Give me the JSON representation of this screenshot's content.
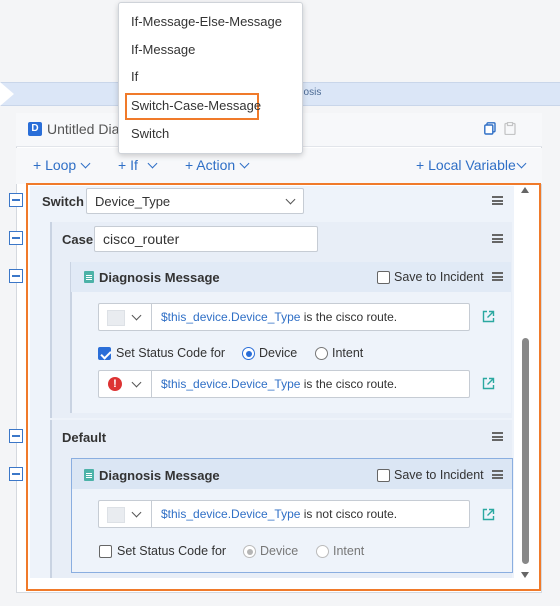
{
  "ribbon": {
    "text": "nosis"
  },
  "editor": {
    "title": "Untitled Dia",
    "badge": "D"
  },
  "toolbar": {
    "loop": "+ Loop",
    "if": "+ If",
    "action": "+ Action",
    "local_variable": "+ Local Variable"
  },
  "menu": {
    "items": [
      {
        "label": "If-Message-Else-Message"
      },
      {
        "label": "If-Message"
      },
      {
        "label": "If"
      },
      {
        "label": "Switch-Case-Message"
      },
      {
        "label": "Switch"
      }
    ]
  },
  "switch_block": {
    "label": "Switch",
    "value": "Device_Type"
  },
  "case_block": {
    "label": "Case",
    "value": "cisco_router"
  },
  "diag1": {
    "title": "Diagnosis Message",
    "save_label": "Save to Incident",
    "msg_var": "$this_device.Device_Type",
    "msg_text": " is the cisco route.",
    "status_label": "Set Status Code for",
    "radio_device": "Device",
    "radio_intent": "Intent",
    "msg2_var": "$this_device.Device_Type",
    "msg2_text": " is the cisco route.",
    "error_glyph": "!"
  },
  "default_block": {
    "label": "Default"
  },
  "diag2": {
    "title": "Diagnosis Message",
    "save_label": "Save to Incident",
    "msg_var": "$this_device.Device_Type",
    "msg_text": " is not cisco route.",
    "status_label": "Set Status Code for",
    "radio_device": "Device",
    "radio_intent": "Intent"
  },
  "colors": {
    "accent": "#2f6fc6",
    "highlight": "#f07a2a",
    "error": "#dd3333"
  }
}
